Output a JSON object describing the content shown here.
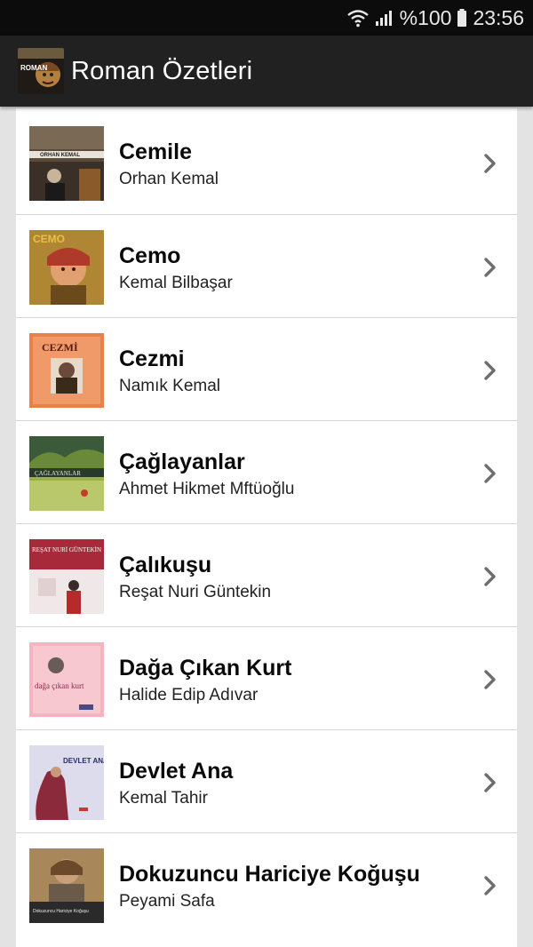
{
  "status_bar": {
    "battery_text": "%100",
    "time": "23:56",
    "icons": [
      "wifi-icon",
      "signal-icon",
      "battery-icon"
    ]
  },
  "app_bar": {
    "title": "Roman Özetleri",
    "logo_text": "ROMAN",
    "logo_icon": "app-logo-icon"
  },
  "books": [
    {
      "title": "Cemile",
      "author": "Orhan Kemal",
      "cover_text": "ORHAN KEMAL",
      "cover_colors": [
        "#5a4a3a",
        "#2a2a2a"
      ]
    },
    {
      "title": "Cemo",
      "author": "Kemal Bilbaşar",
      "cover_text": "CEMO",
      "cover_colors": [
        "#c89a3a",
        "#6a4a1a"
      ]
    },
    {
      "title": "Cezmi",
      "author": "Namık Kemal",
      "cover_text": "CEZMİ",
      "cover_colors": [
        "#e8804a",
        "#f09a6a"
      ]
    },
    {
      "title": "Çağlayanlar",
      "author": "Ahmet Hikmet Mftüoğlu",
      "cover_text": "ÇAĞLAYANLAR",
      "cover_colors": [
        "#4a6a3a",
        "#9ab04a"
      ]
    },
    {
      "title": "Çalıkuşu",
      "author": "Reşat Nuri Güntekin",
      "cover_text": "REŞAT NURİ GÜNTEKİN",
      "cover_colors": [
        "#a82a3a",
        "#f0e8e8"
      ]
    },
    {
      "title": "Dağa Çıkan Kurt",
      "author": "Halide Edip Adıvar",
      "cover_text": "dağa çıkan kurt",
      "cover_colors": [
        "#f4b4c0",
        "#f8c8d0"
      ]
    },
    {
      "title": "Devlet Ana",
      "author": "Kemal Tahir",
      "cover_text": "DEVLET ANA",
      "cover_colors": [
        "#dcdcec",
        "#8a2a3a"
      ]
    },
    {
      "title": "Dokuzuncu Hariciye Koğuşu",
      "author": "Peyami Safa",
      "cover_text": "Dokuzuncu Hariciye Koğuşu",
      "cover_colors": [
        "#8a6a4a",
        "#2a2a2a"
      ]
    }
  ],
  "icons": {
    "chevron": "chevron-right-icon"
  },
  "colors": {
    "status_bar": "#0c0c0c",
    "app_bar": "#212121",
    "background": "#e3e3e3",
    "list": "#ffffff",
    "divider": "#d6d6d6",
    "chevron": "#6e6e6e"
  }
}
